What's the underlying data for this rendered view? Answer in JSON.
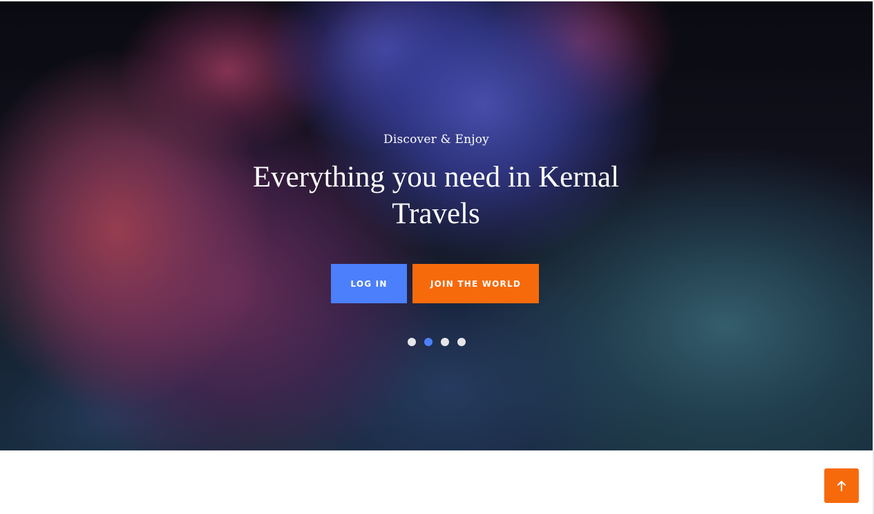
{
  "hero": {
    "subtitle": "Discover & Enjoy",
    "title": "Everything you need in Kernal Travels",
    "buttons": {
      "login_label": "LOG IN",
      "join_label": "JOIN THE WORLD"
    },
    "slider": {
      "slide_count": 4,
      "active_index": 1
    }
  },
  "colors": {
    "primary_blue": "#4c7ffb",
    "accent_orange": "#f76a0c"
  },
  "icons": {
    "back_to_top": "arrow-up-icon"
  }
}
